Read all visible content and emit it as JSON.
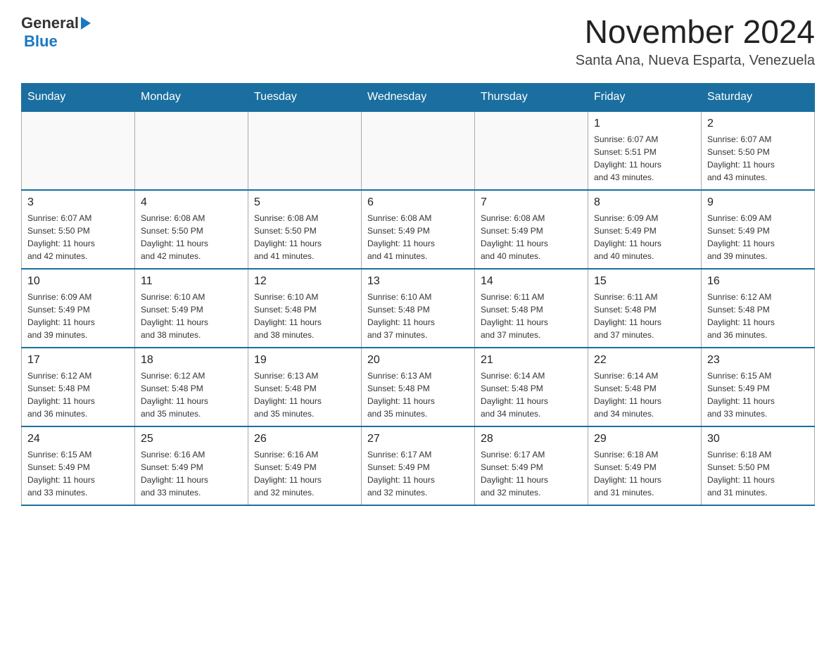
{
  "header": {
    "logo_general": "General",
    "logo_blue": "Blue",
    "month_title": "November 2024",
    "location": "Santa Ana, Nueva Esparta, Venezuela"
  },
  "days_of_week": [
    "Sunday",
    "Monday",
    "Tuesday",
    "Wednesday",
    "Thursday",
    "Friday",
    "Saturday"
  ],
  "weeks": [
    {
      "days": [
        {
          "number": "",
          "info": ""
        },
        {
          "number": "",
          "info": ""
        },
        {
          "number": "",
          "info": ""
        },
        {
          "number": "",
          "info": ""
        },
        {
          "number": "",
          "info": ""
        },
        {
          "number": "1",
          "info": "Sunrise: 6:07 AM\nSunset: 5:51 PM\nDaylight: 11 hours\nand 43 minutes."
        },
        {
          "number": "2",
          "info": "Sunrise: 6:07 AM\nSunset: 5:50 PM\nDaylight: 11 hours\nand 43 minutes."
        }
      ]
    },
    {
      "days": [
        {
          "number": "3",
          "info": "Sunrise: 6:07 AM\nSunset: 5:50 PM\nDaylight: 11 hours\nand 42 minutes."
        },
        {
          "number": "4",
          "info": "Sunrise: 6:08 AM\nSunset: 5:50 PM\nDaylight: 11 hours\nand 42 minutes."
        },
        {
          "number": "5",
          "info": "Sunrise: 6:08 AM\nSunset: 5:50 PM\nDaylight: 11 hours\nand 41 minutes."
        },
        {
          "number": "6",
          "info": "Sunrise: 6:08 AM\nSunset: 5:49 PM\nDaylight: 11 hours\nand 41 minutes."
        },
        {
          "number": "7",
          "info": "Sunrise: 6:08 AM\nSunset: 5:49 PM\nDaylight: 11 hours\nand 40 minutes."
        },
        {
          "number": "8",
          "info": "Sunrise: 6:09 AM\nSunset: 5:49 PM\nDaylight: 11 hours\nand 40 minutes."
        },
        {
          "number": "9",
          "info": "Sunrise: 6:09 AM\nSunset: 5:49 PM\nDaylight: 11 hours\nand 39 minutes."
        }
      ]
    },
    {
      "days": [
        {
          "number": "10",
          "info": "Sunrise: 6:09 AM\nSunset: 5:49 PM\nDaylight: 11 hours\nand 39 minutes."
        },
        {
          "number": "11",
          "info": "Sunrise: 6:10 AM\nSunset: 5:49 PM\nDaylight: 11 hours\nand 38 minutes."
        },
        {
          "number": "12",
          "info": "Sunrise: 6:10 AM\nSunset: 5:48 PM\nDaylight: 11 hours\nand 38 minutes."
        },
        {
          "number": "13",
          "info": "Sunrise: 6:10 AM\nSunset: 5:48 PM\nDaylight: 11 hours\nand 37 minutes."
        },
        {
          "number": "14",
          "info": "Sunrise: 6:11 AM\nSunset: 5:48 PM\nDaylight: 11 hours\nand 37 minutes."
        },
        {
          "number": "15",
          "info": "Sunrise: 6:11 AM\nSunset: 5:48 PM\nDaylight: 11 hours\nand 37 minutes."
        },
        {
          "number": "16",
          "info": "Sunrise: 6:12 AM\nSunset: 5:48 PM\nDaylight: 11 hours\nand 36 minutes."
        }
      ]
    },
    {
      "days": [
        {
          "number": "17",
          "info": "Sunrise: 6:12 AM\nSunset: 5:48 PM\nDaylight: 11 hours\nand 36 minutes."
        },
        {
          "number": "18",
          "info": "Sunrise: 6:12 AM\nSunset: 5:48 PM\nDaylight: 11 hours\nand 35 minutes."
        },
        {
          "number": "19",
          "info": "Sunrise: 6:13 AM\nSunset: 5:48 PM\nDaylight: 11 hours\nand 35 minutes."
        },
        {
          "number": "20",
          "info": "Sunrise: 6:13 AM\nSunset: 5:48 PM\nDaylight: 11 hours\nand 35 minutes."
        },
        {
          "number": "21",
          "info": "Sunrise: 6:14 AM\nSunset: 5:48 PM\nDaylight: 11 hours\nand 34 minutes."
        },
        {
          "number": "22",
          "info": "Sunrise: 6:14 AM\nSunset: 5:48 PM\nDaylight: 11 hours\nand 34 minutes."
        },
        {
          "number": "23",
          "info": "Sunrise: 6:15 AM\nSunset: 5:49 PM\nDaylight: 11 hours\nand 33 minutes."
        }
      ]
    },
    {
      "days": [
        {
          "number": "24",
          "info": "Sunrise: 6:15 AM\nSunset: 5:49 PM\nDaylight: 11 hours\nand 33 minutes."
        },
        {
          "number": "25",
          "info": "Sunrise: 6:16 AM\nSunset: 5:49 PM\nDaylight: 11 hours\nand 33 minutes."
        },
        {
          "number": "26",
          "info": "Sunrise: 6:16 AM\nSunset: 5:49 PM\nDaylight: 11 hours\nand 32 minutes."
        },
        {
          "number": "27",
          "info": "Sunrise: 6:17 AM\nSunset: 5:49 PM\nDaylight: 11 hours\nand 32 minutes."
        },
        {
          "number": "28",
          "info": "Sunrise: 6:17 AM\nSunset: 5:49 PM\nDaylight: 11 hours\nand 32 minutes."
        },
        {
          "number": "29",
          "info": "Sunrise: 6:18 AM\nSunset: 5:49 PM\nDaylight: 11 hours\nand 31 minutes."
        },
        {
          "number": "30",
          "info": "Sunrise: 6:18 AM\nSunset: 5:50 PM\nDaylight: 11 hours\nand 31 minutes."
        }
      ]
    }
  ]
}
